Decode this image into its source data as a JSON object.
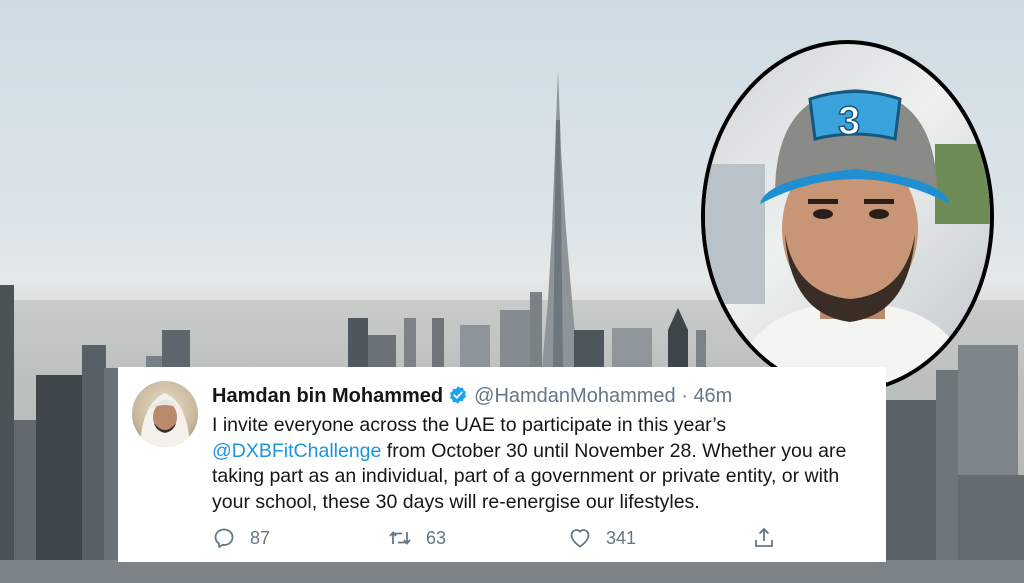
{
  "tweet": {
    "author_name": "Hamdan bin Mohammed",
    "handle": "@HamdanMohammed",
    "separator": "·",
    "time": "46m",
    "text_part1": "I invite everyone across the UAE to participate in this year’s ",
    "mention": "@DXBFitChallenge",
    "text_part2": " from October 30 until November 28. Whether you are taking part as an individual, part of a government or private entity, or with your school, these 30 days will re-energise our lifestyles.",
    "replies": "87",
    "retweets": "63",
    "likes": "341"
  },
  "colors": {
    "verified_badge": "#1da1f2",
    "mention": "#1b95e0",
    "secondary_text": "#657786"
  },
  "icons": {
    "verified": "verified-badge-icon",
    "reply": "reply-icon",
    "retweet": "retweet-icon",
    "like": "heart-icon",
    "share": "share-icon"
  }
}
